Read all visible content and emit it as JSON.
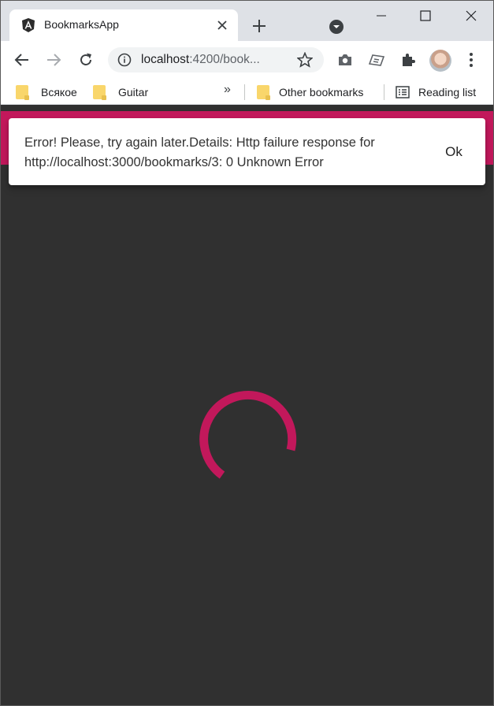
{
  "browser": {
    "tab_title": "BookmarksApp",
    "url_host": "localhost",
    "url_rest": ":4200/book...",
    "bookmarks": [
      {
        "label": "Всякое"
      },
      {
        "label": "Guitar"
      }
    ],
    "overflow_label": "»",
    "other_bookmarks_label": "Other bookmarks",
    "reading_list_label": "Reading list"
  },
  "snackbar": {
    "message": "Error! Please, try again later.Details: Http failure response for http://localhost:3000/bookmarks/3: 0 Unknown Error",
    "action_label": "Ok"
  },
  "colors": {
    "primary": "#c2185b",
    "background": "#303030",
    "folder": "#f9d66b"
  },
  "icons": [
    "angular-icon",
    "close-icon",
    "plus-icon",
    "tab-search-icon",
    "minimize-icon",
    "maximize-icon",
    "window-close-icon",
    "back-icon",
    "forward-icon",
    "reload-icon",
    "info-icon",
    "star-icon",
    "camera-icon",
    "extension-icon",
    "puzzle-icon",
    "avatar",
    "menu-icon",
    "folder-icon",
    "reading-list-icon"
  ]
}
